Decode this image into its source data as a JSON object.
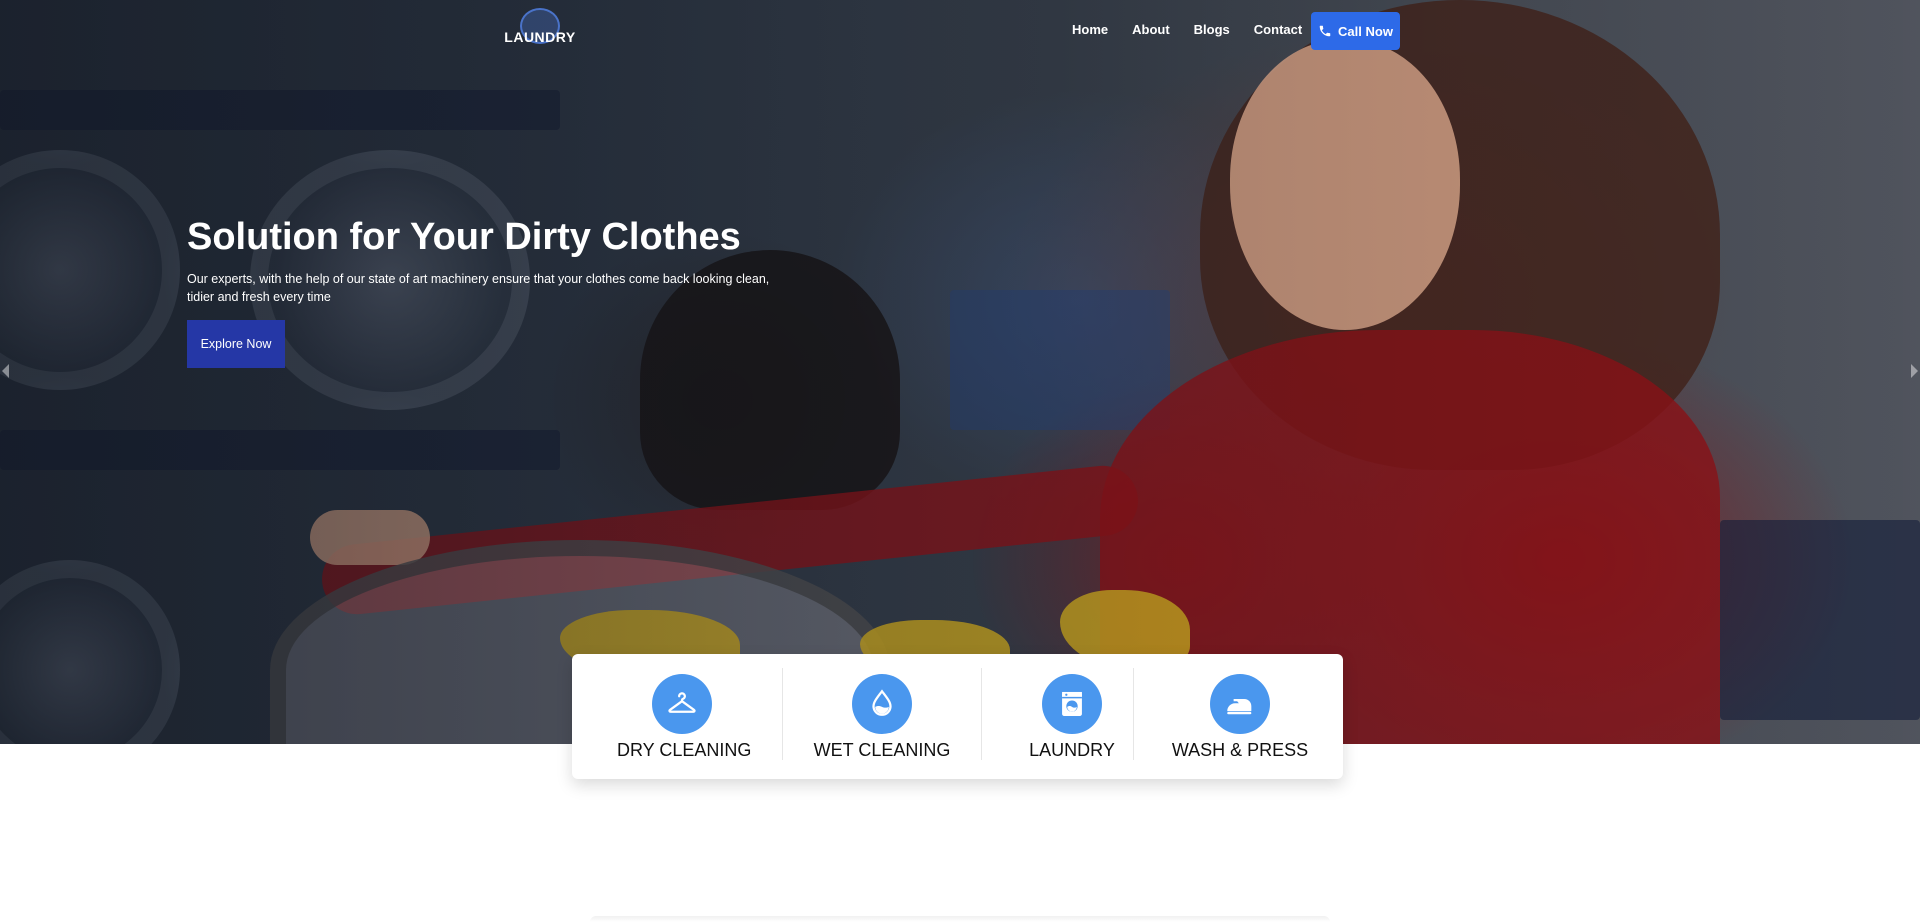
{
  "brand": {
    "logo_text": "LAUNDRY"
  },
  "nav": {
    "items": [
      "Home",
      "About",
      "Blogs",
      "Contact"
    ],
    "call_label": "Call Now"
  },
  "hero": {
    "title": "Solution for Your Dirty Clothes",
    "subtitle": "Our experts, with the help of our state of art machinery ensure that your clothes come back looking clean, tidier and fresh every time",
    "cta_label": "Explore Now"
  },
  "services": [
    {
      "label": "DRY CLEANING",
      "icon": "hanger-icon"
    },
    {
      "label": "WET CLEANING",
      "icon": "water-drop-icon"
    },
    {
      "label": "LAUNDRY",
      "icon": "washing-machine-icon"
    },
    {
      "label": "WASH & PRESS",
      "icon": "iron-icon"
    }
  ],
  "colors": {
    "accent": "#2d6ae8",
    "cta": "#2537a6",
    "service_icon_bg": "#4a97ee"
  }
}
